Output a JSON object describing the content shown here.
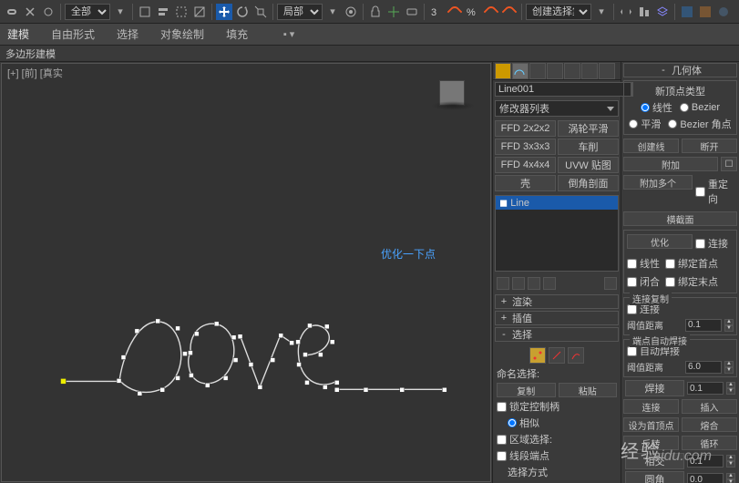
{
  "toolbar": {
    "scope1": "全部",
    "scope2": "局部",
    "create_sel": "创建选择集"
  },
  "tabs": [
    "建模",
    "自由形式",
    "选择",
    "对象绘制",
    "填充"
  ],
  "subheader": "多边形建模",
  "viewport": {
    "label": "[+] [前] [真实",
    "hint": "优化一下点"
  },
  "mod": {
    "name": "Line001",
    "listLabel": "修改器列表",
    "buttons": [
      "FFD 2x2x2",
      "涡轮平滑",
      "FFD 3x3x3",
      "车削",
      "FFD 4x4x4",
      "UVW 贴图",
      "壳",
      "倒角剖面"
    ],
    "stackItem": "Line"
  },
  "rolls": {
    "render": "渲染",
    "interp": "插值",
    "select": "选择",
    "naming": "命名选择:",
    "copy": "复制",
    "paste": "粘贴",
    "lockHandles": "锁定控制柄",
    "similar": "相似",
    "areaSel": "区域选择:",
    "segEnd": "线段端点",
    "selMode": "选择方式"
  },
  "geom": {
    "title": "几何体",
    "newVtxType": "新顶点类型",
    "linear": "线性",
    "bezier": "Bezier",
    "smooth": "平滑",
    "bezcorner": "Bezier 角点",
    "createLine": "创建线",
    "break": "断开",
    "attach": "附加",
    "attachMult": "附加多个",
    "reorient": "重定向",
    "crossSec": "横截面",
    "optimize": "优化",
    "connect": "连接",
    "linearOpt": "线性",
    "bindFirst": "绑定首点",
    "closed": "闭合",
    "bindLast": "绑定末点",
    "copyConn": "连接复制",
    "connCopy": "连接",
    "threshDist": "阈值距离",
    "td_val": "0.1",
    "autoWeld": "端点自动焊接",
    "autoWeldCb": "自动焊接",
    "threshDist2": "阈值距离",
    "td2_val": "6.0",
    "weld": "焊接",
    "w_val": "0.1",
    "connect2": "连接",
    "insert": "插入",
    "setFirst": "设为首顶点",
    "fuse": "熔合",
    "reverse": "反转",
    "cycle": "循环",
    "cross": "相交",
    "c_val": "0.1",
    "fillet": "圆角",
    "f_val": "0.0"
  },
  "wm": "aidu.com",
  "wm2": "经验"
}
